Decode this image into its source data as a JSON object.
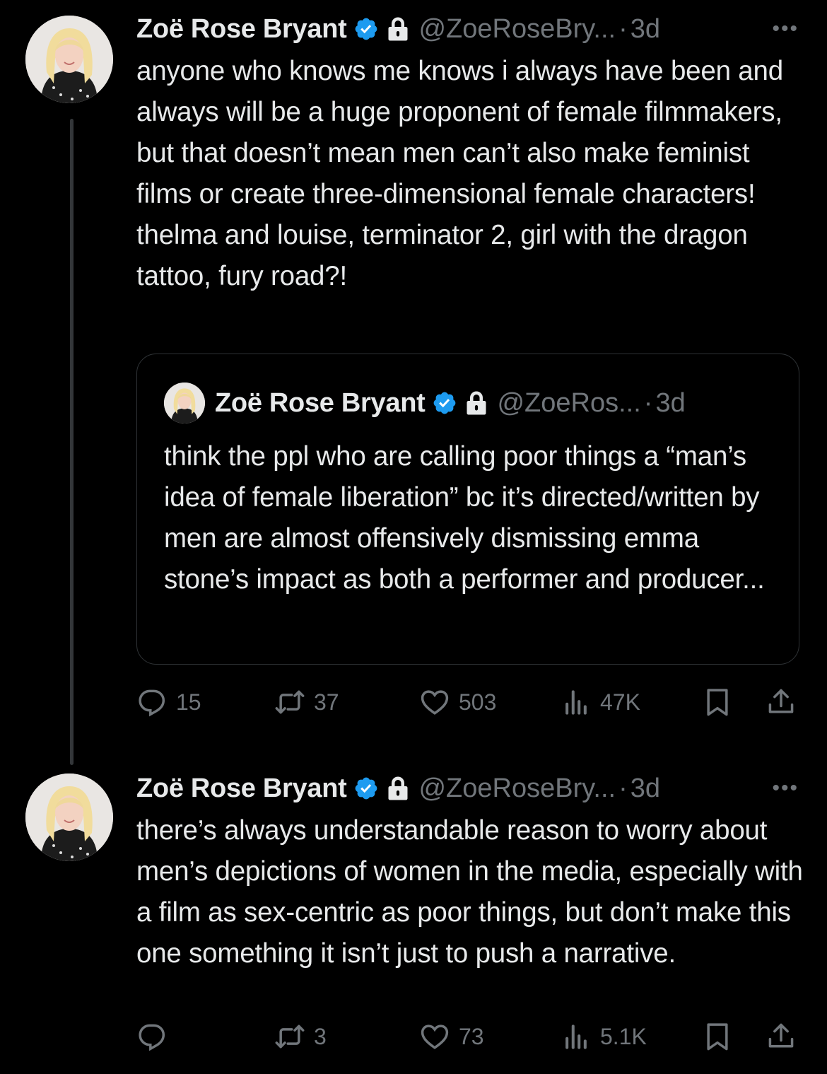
{
  "tweets": [
    {
      "name": "Zoë Rose Bryant",
      "handle": "@ZoeRoseBry...",
      "separator": "·",
      "time": "3d",
      "more": "•••",
      "text": "anyone who knows me knows i always have been and always will be a huge proponent of female filmmakers, but that doesn’t mean men can’t also make feminist films or create three-dimensional female characters! thelma and louise, terminator 2, girl with the dragon tattoo, fury road?!",
      "quote": {
        "name": "Zoë Rose Bryant",
        "handle": "@ZoeRos...",
        "separator": "·",
        "time": "3d",
        "text": "think the ppl who are calling poor things a “man’s idea of female liberation” bc it’s directed/written by men are almost offensively dismissing emma stone’s impact as both a performer and producer..."
      },
      "stats": {
        "replies": "15",
        "reposts": "37",
        "likes": "503",
        "views": "47K"
      }
    },
    {
      "name": "Zoë Rose Bryant",
      "handle": "@ZoeRoseBry...",
      "separator": "·",
      "time": "3d",
      "more": "•••",
      "text": "there’s always understandable reason to worry about men’s depictions of women in the media, especially with a film as sex-centric as poor things, but don’t make this one something it isn’t just to push a narrative.",
      "stats": {
        "replies": "",
        "reposts": "3",
        "likes": "73",
        "views": "5.1K"
      }
    }
  ],
  "colors": {
    "background": "#000000",
    "text": "#e7e9ea",
    "muted": "#71767b",
    "verified": "#1d9bf0"
  },
  "icons": [
    "verified-badge-icon",
    "lock-icon",
    "reply-icon",
    "repost-icon",
    "like-icon",
    "views-icon",
    "bookmark-icon",
    "share-icon"
  ]
}
